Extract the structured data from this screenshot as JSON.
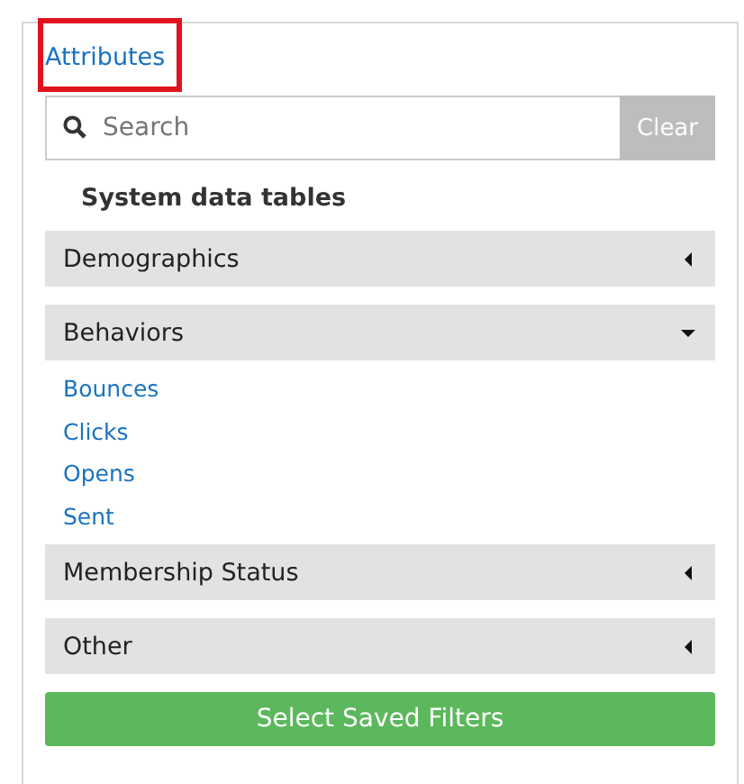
{
  "header_link": {
    "label": "Attributes",
    "highlighted": true
  },
  "search": {
    "placeholder": "Search",
    "clear_label": "Clear"
  },
  "heading": "System data tables",
  "sections": [
    {
      "label": "Demographics",
      "expanded": false
    },
    {
      "label": "Behaviors",
      "expanded": true,
      "items": [
        "Bounces",
        "Clicks",
        "Opens",
        "Sent"
      ]
    },
    {
      "label": "Membership Status",
      "expanded": false
    },
    {
      "label": "Other",
      "expanded": false
    }
  ],
  "footer_button": "Select Saved Filters"
}
